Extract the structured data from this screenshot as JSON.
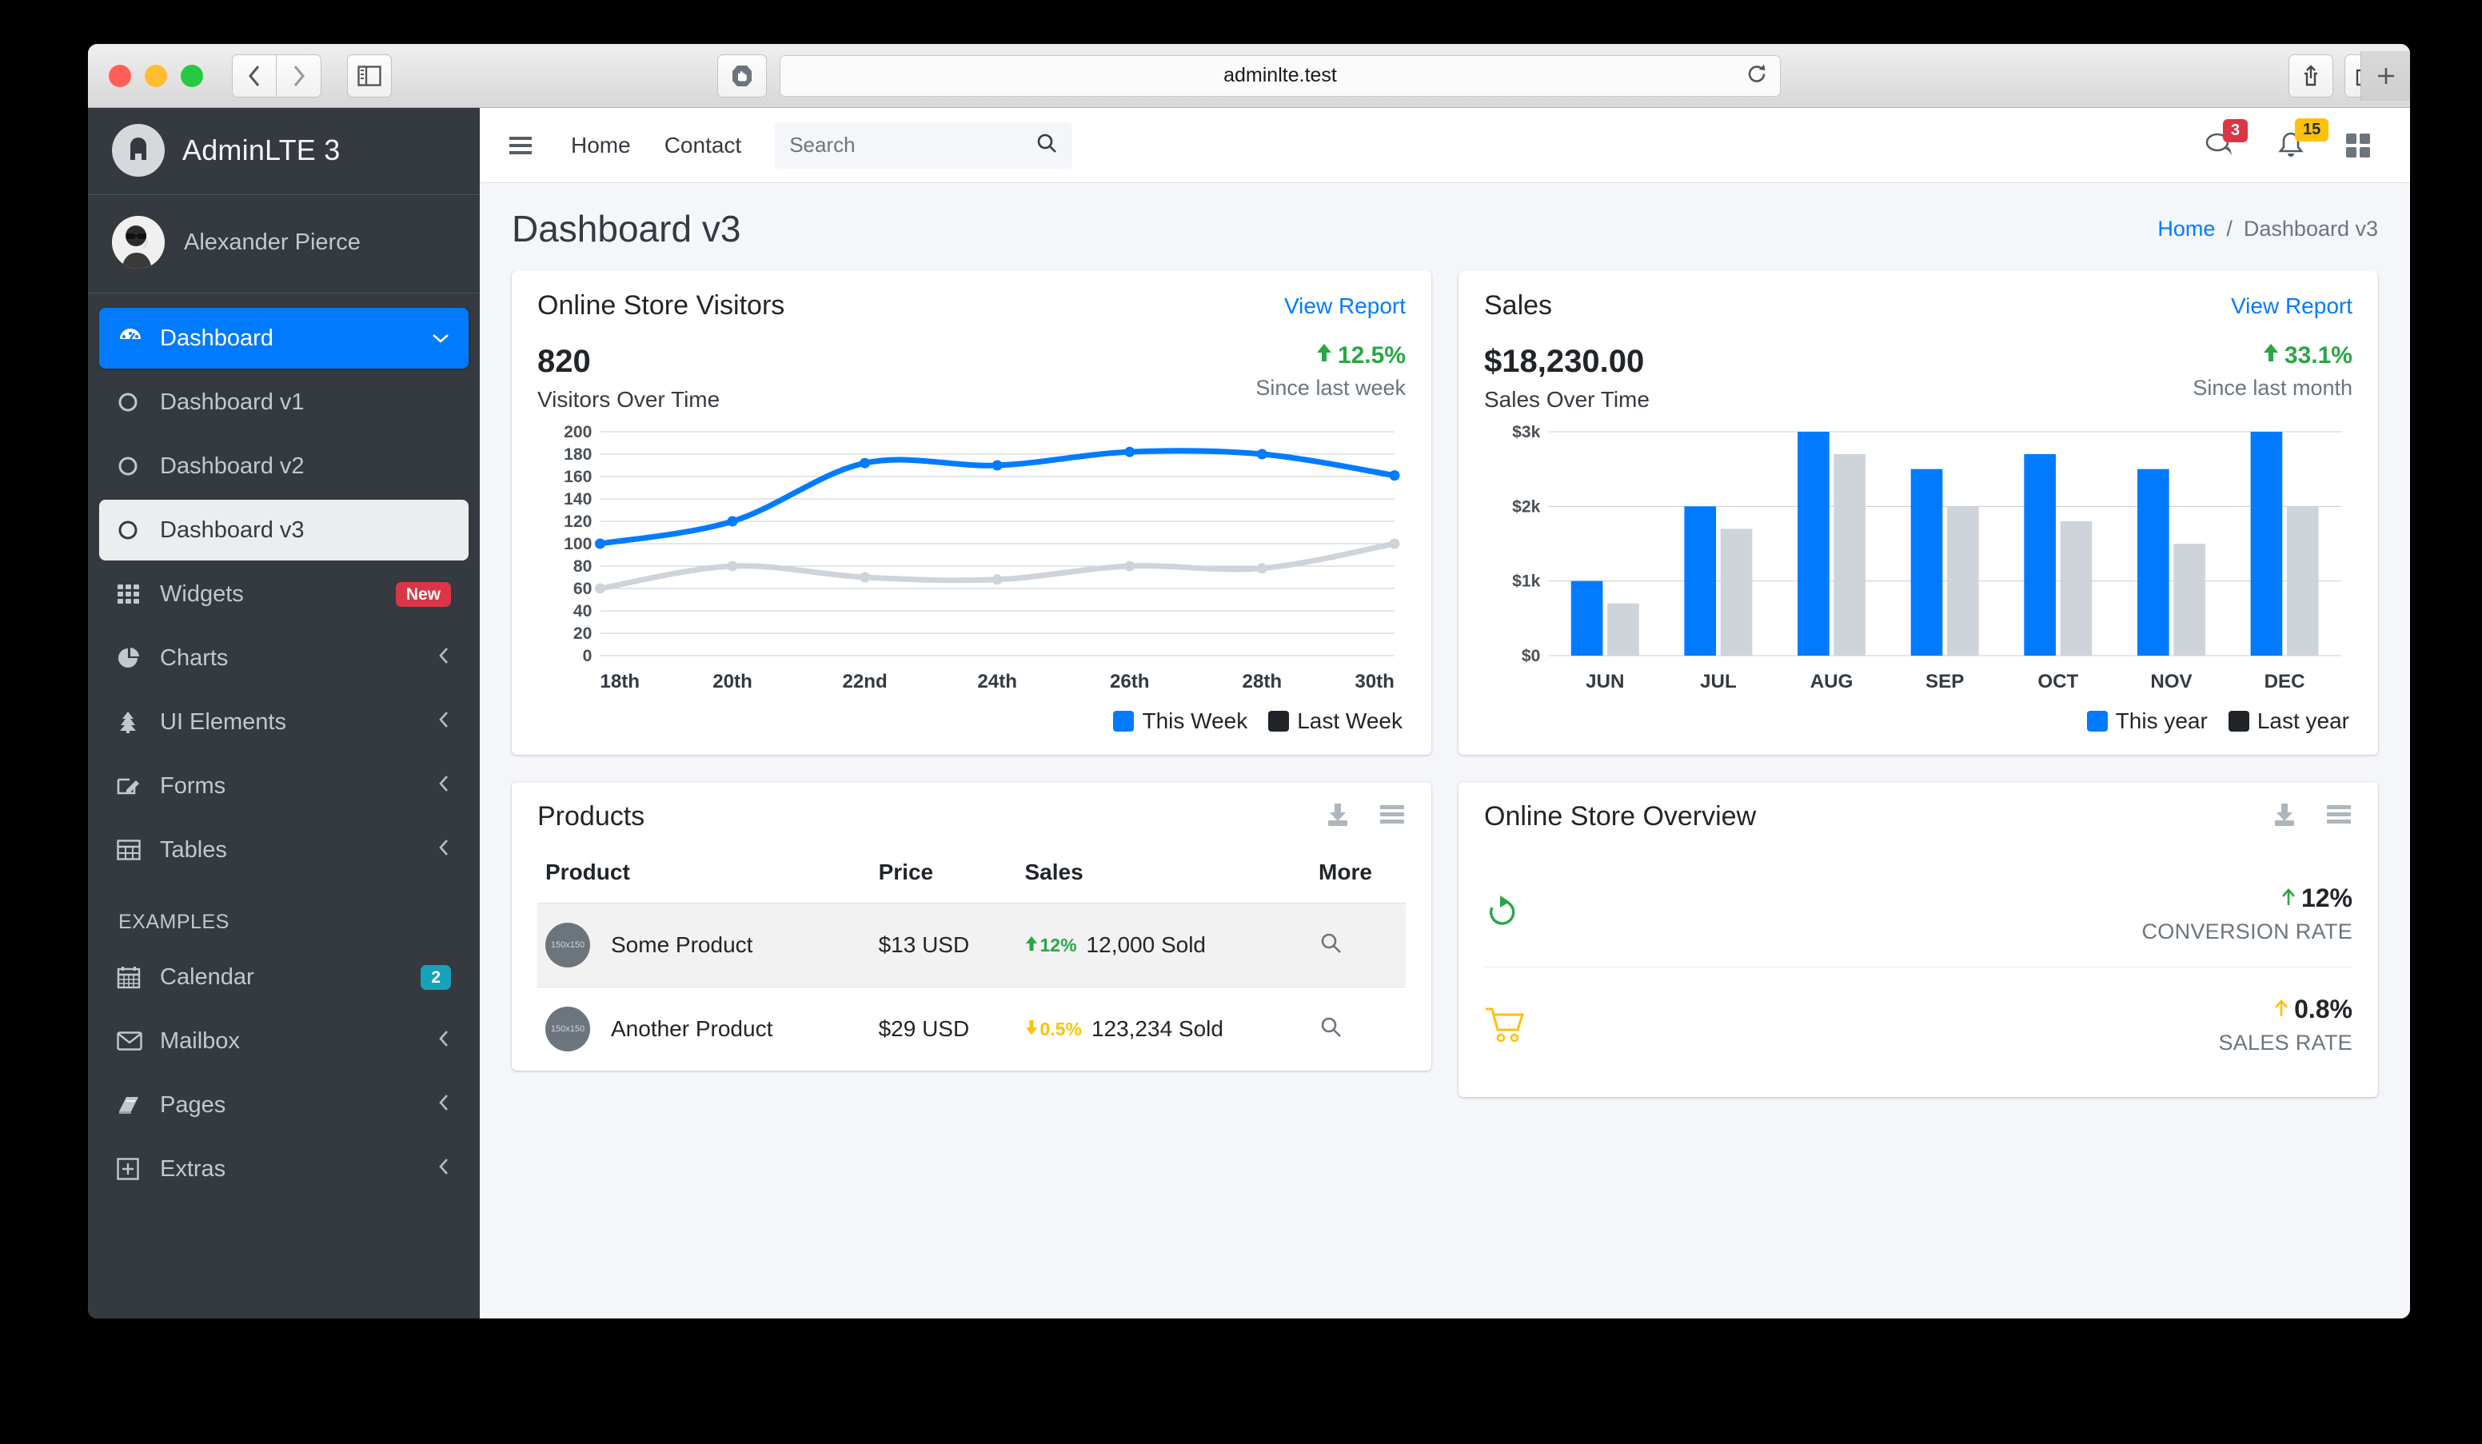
{
  "browser": {
    "url": "adminlte.test",
    "back_icon": "chevron-left-icon",
    "forward_icon": "chevron-right-icon",
    "sidebar_toggle_icon": "sidebar-panel-icon",
    "shield_icon": "adblock-shield-icon",
    "reload_icon": "reload-icon",
    "share_icon": "share-icon",
    "tabs_icon": "tabs-overview-icon",
    "newtab_icon": "plus-icon"
  },
  "sidebar": {
    "brand": "AdminLTE 3",
    "brand_logo_icon": "adminlte-logo-icon",
    "user": "Alexander Pierce",
    "avatar_icon": "user-avatar",
    "items": [
      {
        "label": "Dashboard",
        "icon": "tachometer-icon",
        "state": "active",
        "chevron": "chevron-down-icon"
      },
      {
        "label": "Dashboard v1",
        "icon": "circle-icon",
        "state": "child"
      },
      {
        "label": "Dashboard v2",
        "icon": "circle-icon",
        "state": "child"
      },
      {
        "label": "Dashboard v3",
        "icon": "circle-icon",
        "state": "active-light"
      },
      {
        "label": "Widgets",
        "icon": "th-grid-icon",
        "state": "normal",
        "badge": "New",
        "badge_color": "#dc3545"
      },
      {
        "label": "Charts",
        "icon": "pie-chart-icon",
        "state": "normal",
        "chevron": "chevron-left-icon"
      },
      {
        "label": "UI Elements",
        "icon": "tree-icon",
        "state": "normal",
        "chevron": "chevron-left-icon"
      },
      {
        "label": "Forms",
        "icon": "edit-icon",
        "state": "normal",
        "chevron": "chevron-left-icon"
      },
      {
        "label": "Tables",
        "icon": "table-icon",
        "state": "normal",
        "chevron": "chevron-left-icon"
      }
    ],
    "section_header": "EXAMPLES",
    "example_items": [
      {
        "label": "Calendar",
        "icon": "calendar-icon",
        "badge": "2",
        "badge_color": "#17a2b8"
      },
      {
        "label": "Mailbox",
        "icon": "envelope-icon",
        "chevron": "chevron-left-icon"
      },
      {
        "label": "Pages",
        "icon": "book-icon",
        "chevron": "chevron-left-icon"
      },
      {
        "label": "Extras",
        "icon": "plus-square-icon",
        "chevron": "chevron-left-icon"
      }
    ]
  },
  "navbar": {
    "hamburger_icon": "hamburger-icon",
    "links": [
      "Home",
      "Contact"
    ],
    "search_placeholder": "Search",
    "search_value": "",
    "search_icon": "search-icon",
    "messages_icon": "comments-icon",
    "messages_count": "3",
    "notifications_icon": "bell-icon",
    "notifications_count": "15",
    "apps_icon": "th-large-icon"
  },
  "header": {
    "title": "Dashboard v3",
    "breadcrumb_home": "Home",
    "breadcrumb_sep": "/",
    "breadcrumb_current": "Dashboard v3"
  },
  "visitors_card": {
    "title": "Online Store Visitors",
    "view_report": "View Report",
    "value": "820",
    "subtitle": "Visitors Over Time",
    "change_pct": "12.5%",
    "change_arrow": "arrow-up-icon",
    "change_period": "Since last week"
  },
  "sales_card": {
    "title": "Sales",
    "view_report": "View Report",
    "value": "$18,230.00",
    "subtitle": "Sales Over Time",
    "change_pct": "33.1%",
    "change_arrow": "arrow-up-icon",
    "change_period": "Since last month"
  },
  "products_card": {
    "title": "Products",
    "download_icon": "download-icon",
    "menu_icon": "bars-icon",
    "columns": [
      "Product",
      "Price",
      "Sales",
      "More"
    ],
    "rows": [
      {
        "product": "Some Product",
        "thumb": "150x150",
        "price": "$13 USD",
        "pct": "12%",
        "direction": "up",
        "sold": "12,000 Sold",
        "more_icon": "search-icon"
      },
      {
        "product": "Another Product",
        "thumb": "150x150",
        "price": "$29 USD",
        "pct": "0.5%",
        "direction": "down",
        "sold": "123,234 Sold",
        "more_icon": "search-icon"
      }
    ]
  },
  "overview_card": {
    "title": "Online Store Overview",
    "download_icon": "download-icon",
    "menu_icon": "bars-icon",
    "rows": [
      {
        "icon": "refresh-circle-icon",
        "icon_color": "#28a745",
        "value": "12%",
        "arrow": "arrow-up-icon",
        "arrow_color": "#28a745",
        "label": "CONVERSION RATE"
      },
      {
        "icon": "shopping-cart-icon",
        "icon_color": "#ffc107",
        "value": "0.8%",
        "arrow": "arrow-up-icon",
        "arrow_color": "#ffc107",
        "label": "SALES RATE"
      }
    ]
  },
  "chart_data": [
    {
      "type": "line",
      "title": "Visitors Over Time",
      "categories": [
        "18th",
        "20th",
        "22nd",
        "24th",
        "26th",
        "28th",
        "30th"
      ],
      "series": [
        {
          "name": "This Week",
          "color": "#007bff",
          "values": [
            100,
            120,
            172,
            170,
            182,
            180,
            161
          ]
        },
        {
          "name": "Last Week",
          "color": "#ced4da",
          "values": [
            60,
            80,
            70,
            68,
            80,
            78,
            100
          ]
        }
      ],
      "ylim": [
        0,
        200
      ],
      "yticks": [
        0,
        20,
        40,
        60,
        80,
        100,
        120,
        140,
        160,
        180,
        200
      ],
      "xlabel": "",
      "ylabel": "",
      "grid": true,
      "legend_position": "bottom-right"
    },
    {
      "type": "bar",
      "title": "Sales Over Time",
      "categories": [
        "JUN",
        "JUL",
        "AUG",
        "SEP",
        "OCT",
        "NOV",
        "DEC"
      ],
      "series": [
        {
          "name": "This year",
          "color": "#007bff",
          "values": [
            1000,
            2000,
            3000,
            2500,
            2700,
            2500,
            3000
          ]
        },
        {
          "name": "Last year",
          "color": "#ced4da",
          "values": [
            700,
            1700,
            2700,
            2000,
            1800,
            1500,
            2000
          ]
        }
      ],
      "ylim": [
        0,
        3000
      ],
      "yticks": [
        0,
        1000,
        2000,
        3000
      ],
      "ytick_labels": [
        "$0",
        "$1k",
        "$2k",
        "$3k"
      ],
      "xlabel": "",
      "ylabel": "",
      "grid": true,
      "legend_position": "bottom-right"
    }
  ]
}
